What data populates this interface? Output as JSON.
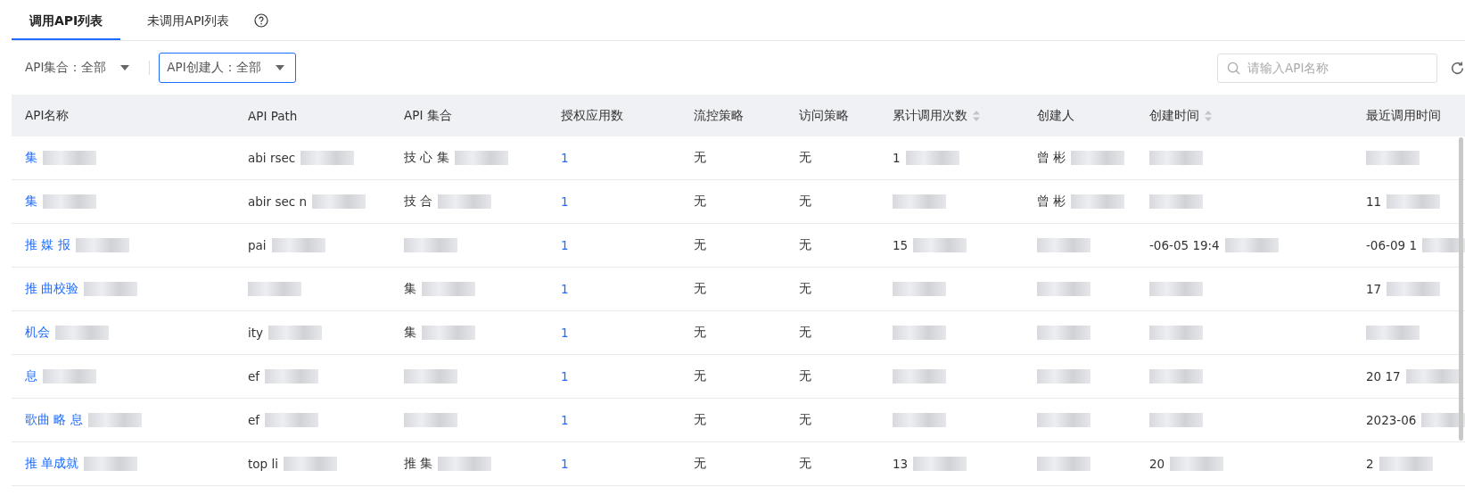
{
  "tabs": [
    {
      "label": "调用API列表",
      "selected": true
    },
    {
      "label": "未调用API列表",
      "selected": false,
      "help": true
    }
  ],
  "filters": [
    {
      "label": "API集合：全部",
      "focused": false
    },
    {
      "label": "API创建人：全部",
      "focused": true
    }
  ],
  "search": {
    "placeholder": "请输入API名称"
  },
  "table": {
    "columns": [
      {
        "label": "API名称"
      },
      {
        "label": "API Path"
      },
      {
        "label": "API 集合"
      },
      {
        "label": "授权应用数"
      },
      {
        "label": "流控策略"
      },
      {
        "label": "访问策略"
      },
      {
        "label": "累计调用次数",
        "sortable": true
      },
      {
        "label": "创建人"
      },
      {
        "label": "创建时间",
        "sortable": true
      },
      {
        "label": "最近调用时间"
      }
    ],
    "rows": [
      [
        {
          "text": "集",
          "link": true,
          "redacted": true
        },
        {
          "text": "abi rsec",
          "redacted": true
        },
        {
          "text": "技 心 集",
          "redacted": true
        },
        {
          "text": "1",
          "link": true
        },
        {
          "text": "无"
        },
        {
          "text": "无"
        },
        {
          "text": "1",
          "redacted": true
        },
        {
          "text": "曾 彬",
          "redacted": true
        },
        {
          "redacted": true
        },
        {
          "redacted": true
        }
      ],
      [
        {
          "text": "集",
          "link": true,
          "redacted": true
        },
        {
          "text": "abir sec n",
          "redacted": true
        },
        {
          "text": "技 合",
          "redacted": true
        },
        {
          "text": "1",
          "link": true
        },
        {
          "text": "无"
        },
        {
          "text": "无"
        },
        {
          "redacted": true
        },
        {
          "text": "曾 彬",
          "redacted": true
        },
        {
          "redacted": true
        },
        {
          "text": "11",
          "redacted": true
        }
      ],
      [
        {
          "text": "推 媒 报",
          "link": true,
          "redacted": true
        },
        {
          "text": "pai",
          "redacted": true
        },
        {
          "redacted": true
        },
        {
          "text": "1",
          "link": true
        },
        {
          "text": "无"
        },
        {
          "text": "无"
        },
        {
          "text": "15",
          "redacted": true
        },
        {
          "redacted": true
        },
        {
          "text": "-06-05 19:4",
          "redacted": true
        },
        {
          "text": "-06-09 1",
          "redacted": true
        }
      ],
      [
        {
          "text": "推 曲校验",
          "link": true,
          "redacted": true
        },
        {
          "redacted": true
        },
        {
          "text": "集",
          "redacted": true
        },
        {
          "text": "1",
          "link": true
        },
        {
          "text": "无"
        },
        {
          "text": "无"
        },
        {
          "redacted": true
        },
        {
          "redacted": true
        },
        {
          "redacted": true
        },
        {
          "text": "17",
          "redacted": true
        }
      ],
      [
        {
          "text": "机会",
          "link": true,
          "redacted": true
        },
        {
          "text": "ity",
          "redacted": true
        },
        {
          "text": "集",
          "redacted": true
        },
        {
          "text": "1",
          "link": true
        },
        {
          "text": "无"
        },
        {
          "text": "无"
        },
        {
          "redacted": true
        },
        {
          "redacted": true
        },
        {
          "redacted": true
        },
        {
          "redacted": true
        }
      ],
      [
        {
          "text": "息",
          "link": true,
          "redacted": true
        },
        {
          "text": "ef",
          "redacted": true
        },
        {
          "redacted": true
        },
        {
          "text": "1",
          "link": true
        },
        {
          "text": "无"
        },
        {
          "text": "无"
        },
        {
          "redacted": true
        },
        {
          "redacted": true
        },
        {
          "redacted": true
        },
        {
          "text": "20 17",
          "redacted": true
        }
      ],
      [
        {
          "text": "歌曲 略 息",
          "link": true,
          "redacted": true
        },
        {
          "text": "ef",
          "redacted": true
        },
        {
          "redacted": true
        },
        {
          "text": "1",
          "link": true
        },
        {
          "text": "无"
        },
        {
          "text": "无"
        },
        {
          "redacted": true
        },
        {
          "redacted": true
        },
        {
          "redacted": true
        },
        {
          "text": "2023-06",
          "redacted": true
        }
      ],
      [
        {
          "text": "推 单成就",
          "link": true,
          "redacted": true
        },
        {
          "text": "top li",
          "redacted": true
        },
        {
          "text": "推 集",
          "redacted": true
        },
        {
          "text": "1",
          "link": true
        },
        {
          "text": "无"
        },
        {
          "text": "无"
        },
        {
          "text": "13",
          "redacted": true
        },
        {
          "redacted": true
        },
        {
          "text": "20",
          "redacted": true
        },
        {
          "text": "2",
          "redacted": true
        }
      ]
    ]
  }
}
